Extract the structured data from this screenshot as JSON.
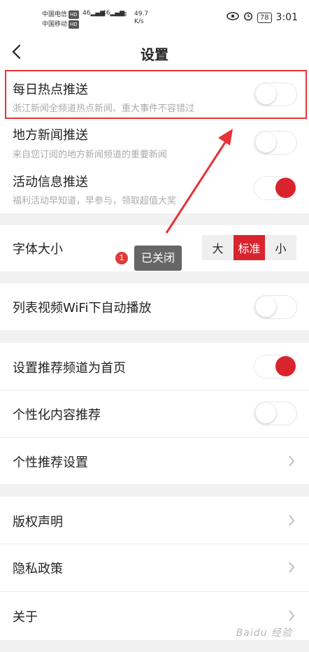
{
  "status": {
    "carrier1": "中国电信",
    "carrier2": "中国移动",
    "hd": "HD",
    "sig1": "46",
    "sig2": "46",
    "speed_value": "49.7",
    "speed_unit": "K/s",
    "battery": "78",
    "time": "3:01"
  },
  "nav": {
    "title": "设置"
  },
  "push": [
    {
      "title": "每日热点推送",
      "subtitle": "浙江新闻全频道热点新闻、重大事件不容错过",
      "on": false
    },
    {
      "title": "地方新闻推送",
      "subtitle": "来自您订阅的地方新闻频道的重要新闻",
      "on": false
    },
    {
      "title": "活动信息推送",
      "subtitle": "福利活动早知道，早参与，领取超值大奖",
      "on": true
    }
  ],
  "font_size": {
    "label": "字体大小",
    "options": [
      "大",
      "标准",
      "小"
    ],
    "selected": "标准"
  },
  "video": {
    "title": "列表视频WiFi下自动播放",
    "on": false
  },
  "recommend": [
    {
      "title": "设置推荐频道为首页",
      "on": true
    },
    {
      "title": "个性化内容推荐",
      "on": false
    },
    {
      "title": "个性推荐设置"
    }
  ],
  "about": [
    {
      "title": "版权声明"
    },
    {
      "title": "隐私政策"
    },
    {
      "title": "关于"
    }
  ],
  "annotation": {
    "step": "1",
    "label": "已关闭",
    "color": "#e53238"
  },
  "accent_color": "#d9232d",
  "watermark": "Baidu 经验"
}
